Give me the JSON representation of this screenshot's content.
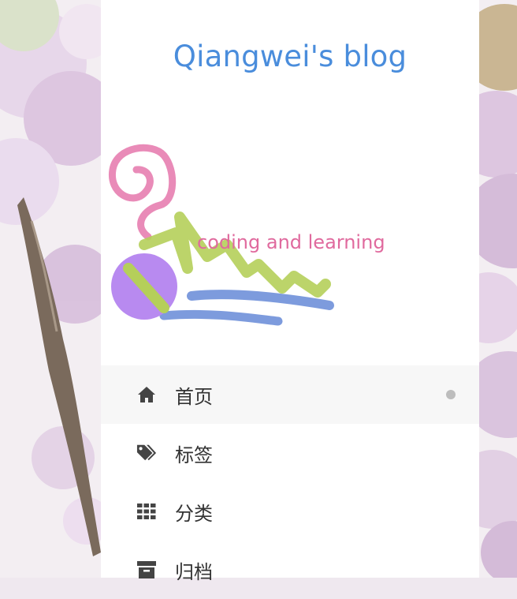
{
  "site": {
    "title": "Qiangwei's blog",
    "tagline": "coding and learning"
  },
  "menu": [
    {
      "label": "首页",
      "icon": "home-icon",
      "active": true
    },
    {
      "label": "标签",
      "icon": "tags-icon",
      "active": false
    },
    {
      "label": "分类",
      "icon": "th-icon",
      "active": false
    },
    {
      "label": "归档",
      "icon": "archive-icon",
      "active": false
    }
  ],
  "colors": {
    "title": "#4a8ddc",
    "tagline": "#e06a9e",
    "menu_text": "#333333",
    "active_bg": "#f7f7f7",
    "active_dot": "#bdbdbd"
  }
}
